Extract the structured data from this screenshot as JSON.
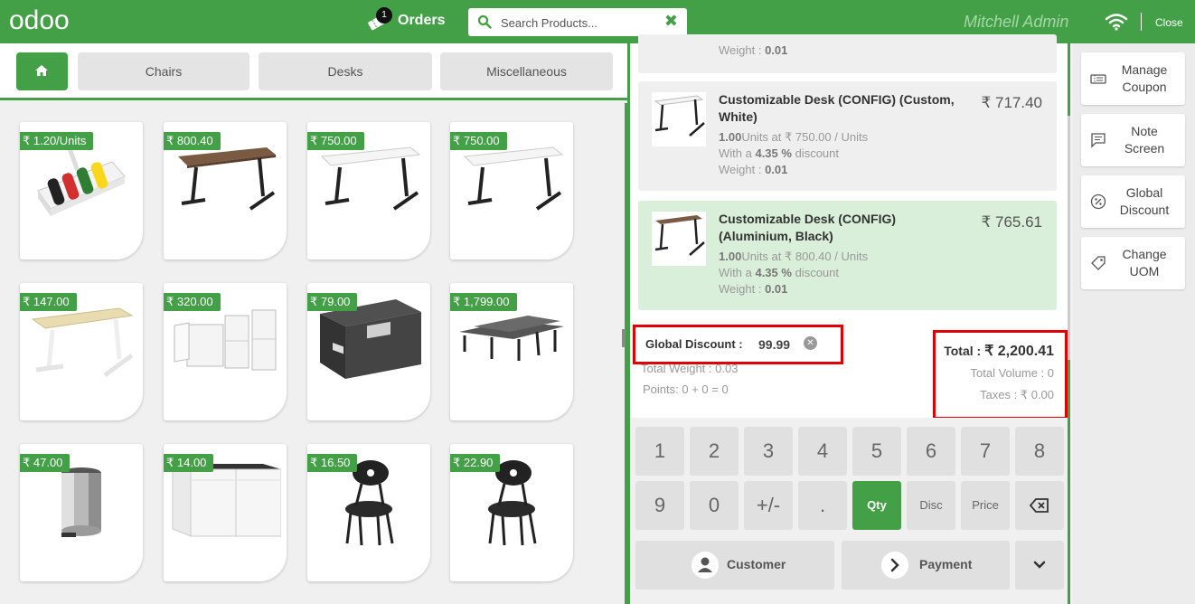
{
  "header": {
    "logo": "odoo",
    "orders_badge": "1",
    "orders_label": "Orders",
    "search_placeholder": "Search Products...",
    "user_name": "Mitchell Admin",
    "close_label": "Close"
  },
  "categories": [
    "Chairs",
    "Desks",
    "Miscellaneous"
  ],
  "products": [
    {
      "price": "₹ 1.20/Units",
      "icon": "marker-organizer"
    },
    {
      "price": "₹ 800.40",
      "icon": "desk-dark"
    },
    {
      "price": "₹ 750.00",
      "icon": "desk-white"
    },
    {
      "price": "₹ 750.00",
      "icon": "desk-white"
    },
    {
      "price": "₹ 147.00",
      "icon": "desk-beige"
    },
    {
      "price": "₹ 320.00",
      "icon": "white-cabinets"
    },
    {
      "price": "₹ 79.00",
      "icon": "storage-box"
    },
    {
      "price": "₹ 1,799.00",
      "icon": "desk-cluster"
    },
    {
      "price": "₹ 47.00",
      "icon": "pedal-bin"
    },
    {
      "price": "₹ 14.00",
      "icon": "sideboard"
    },
    {
      "price": "₹ 16.50",
      "icon": "office-chair"
    },
    {
      "price": "₹ 22.90",
      "icon": "office-chair"
    }
  ],
  "order": {
    "partial_line_weight_label": "Weight :",
    "partial_line_weight": "0.01",
    "lines": [
      {
        "name": "Customizable Desk (CONFIG) (Custom, White)",
        "total": "₹ 717.40",
        "qty": "1.00",
        "unit_text": "Units at ₹ 750.00 / Units",
        "discount_prefix": "With a",
        "discount": "4.35 %",
        "discount_suffix": "discount",
        "weight_label": "Weight :",
        "weight": "0.01",
        "icon": "desk-white"
      },
      {
        "name": "Customizable Desk (CONFIG) (Aluminium, Black)",
        "total": "₹ 765.61",
        "qty": "1.00",
        "unit_text": "Units at ₹ 800.40 / Units",
        "discount_prefix": "With a",
        "discount": "4.35 %",
        "discount_suffix": "discount",
        "weight_label": "Weight :",
        "weight": "0.01",
        "icon": "desk-dark"
      }
    ],
    "global_discount_label": "Global Discount :",
    "global_discount_value": "99.99",
    "total_weight": "Total Weight : 0.03",
    "points": "Points: 0 + 0 = 0",
    "total_label": "Total :",
    "total_value": "₹ 2,200.41",
    "total_volume": "Total Volume : 0",
    "taxes": "Taxes : ₹ 0.00"
  },
  "numpad": {
    "row1": [
      "1",
      "2",
      "3",
      "4",
      "5",
      "6",
      "7",
      "8"
    ],
    "row2": [
      "9",
      "0",
      "+/-",
      ".",
      "Qty",
      "Disc",
      "Price",
      "⌫"
    ],
    "active_mode": "Qty",
    "customer_label": "Customer",
    "payment_label": "Payment"
  },
  "controls": [
    {
      "label": "Manage Coupon",
      "icon": "coupon-icon"
    },
    {
      "label": "Note Screen",
      "icon": "note-icon"
    },
    {
      "label": "Global Discount",
      "icon": "percent-icon"
    },
    {
      "label": "Change UOM",
      "icon": "tag-icon"
    }
  ],
  "colors": {
    "brand": "#43a047",
    "highlight_border": "#e00000",
    "selected_line": "#d9efd9"
  }
}
